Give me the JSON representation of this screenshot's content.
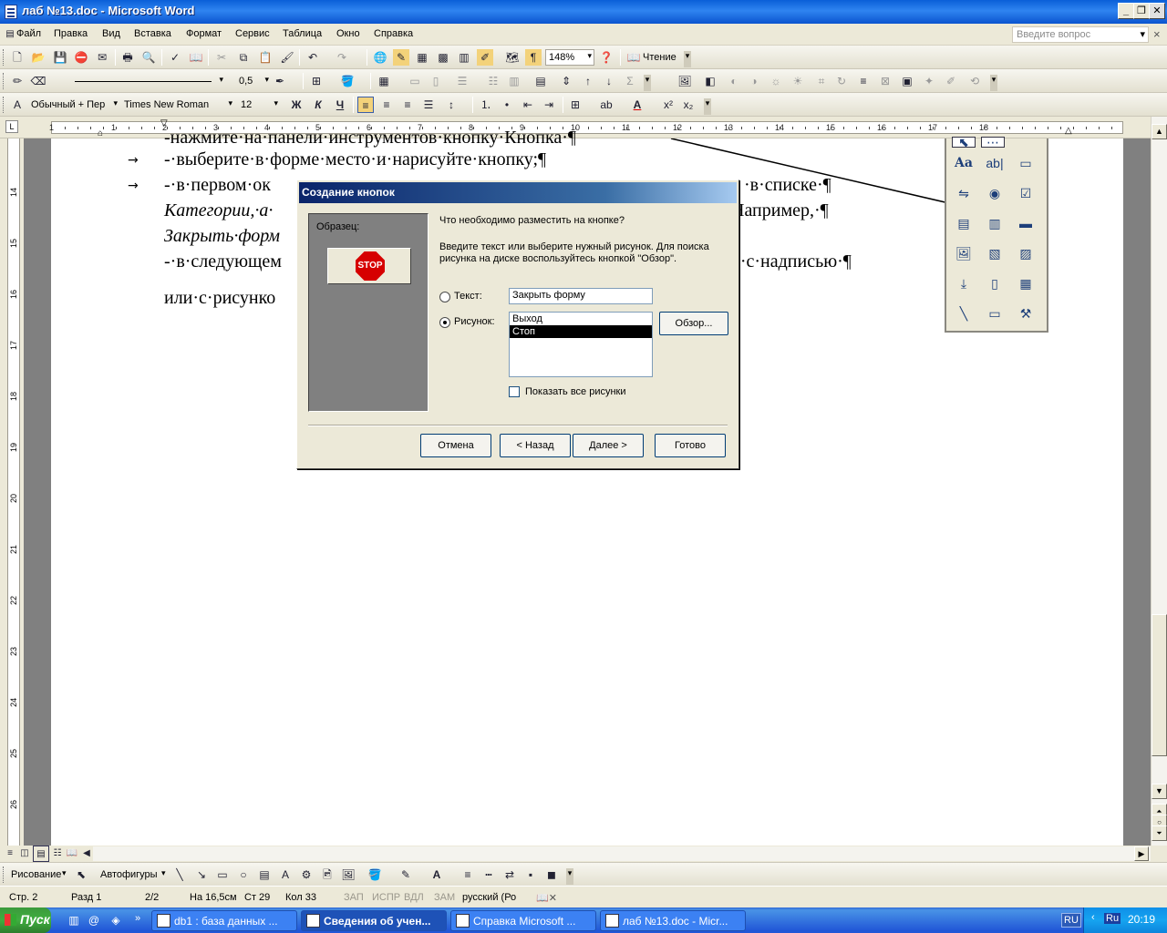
{
  "window": {
    "title": "лаб №13.doc - Microsoft Word"
  },
  "menu": {
    "items": [
      "Файл",
      "Правка",
      "Вид",
      "Вставка",
      "Формат",
      "Сервис",
      "Таблица",
      "Окно",
      "Справка"
    ],
    "help_placeholder": "Введите вопрос"
  },
  "toolbar_standard": {
    "zoom": "148%",
    "reading": "Чтение"
  },
  "toolbar_tables": {
    "line_weight": "0,5"
  },
  "toolbar_format": {
    "style": "Обычный + Пер",
    "font": "Times New Roman",
    "size": "12",
    "bold": "Ж",
    "italic": "К",
    "underline": "Ч"
  },
  "ruler": {
    "numbers": [
      "1",
      "1",
      "2",
      "3",
      "4",
      "5",
      "6",
      "7",
      "8",
      "9",
      "10",
      "11",
      "12",
      "13",
      "14",
      "15",
      "16",
      "17",
      "18"
    ],
    "vnumbers": [
      "14",
      "15",
      "16",
      "17",
      "18",
      "19",
      "20",
      "21",
      "22",
      "23",
      "24",
      "25",
      "26"
    ]
  },
  "document": {
    "line1": "-нажмите·на·панели·инструментов·кнопку·Кнопка·¶",
    "line2": "-·выберите·в·форме·место·и·нарисуйте·кнопку;¶",
    "line3a": "-·в·первом·ок",
    "line3b": "·в·списке·¶",
    "line4a": "Категории,·а·",
    "line4b": "Например,·¶",
    "line5a": "Закрыть·форм",
    "line6a": "-·в·следующем",
    "line6b": "ка:·с·надписью·¶",
    "line7a": "или·с·рисунко"
  },
  "dialog": {
    "title": "Создание кнопок",
    "sample_label": "Образец:",
    "sample_icon": "STOP",
    "question": "Что необходимо разместить на кнопке?",
    "instruction1": "Введите текст или выберите нужный рисунок.  Для поиска",
    "instruction2": "рисунка на диске воспользуйтесь кнопкой \"Обзор\".",
    "text_option": "Текст:",
    "text_value": "Закрыть форму",
    "picture_option": "Рисунок:",
    "picture_list": [
      "Выход",
      "Стоп"
    ],
    "selected_picture": "Стоп",
    "browse": "Обзор...",
    "show_all": "Показать все рисунки",
    "cancel": "Отмена",
    "back": "< Назад",
    "next": "Далее >",
    "finish": "Готово"
  },
  "drawbar": {
    "draw": "Рисование",
    "autoshapes": "Автофигуры"
  },
  "status": {
    "page": "Стр. 2",
    "section": "Разд 1",
    "pages": "2/2",
    "position": "На 16,5см",
    "line": "Ст 29",
    "col": "Кол 33",
    "rec": "ЗАП",
    "trk": "ИСПР",
    "ext": "ВДЛ",
    "ovr": "ЗАМ",
    "lang": "русский (Ро"
  },
  "taskbar": {
    "start": "Пуск",
    "tasks": [
      "db1 : база данных ...",
      "Сведения об учен...",
      "Справка Microsoft ...",
      "лаб №13.doc - Micr..."
    ],
    "lang": "RU",
    "kb": "Ru",
    "time": "20:19"
  }
}
